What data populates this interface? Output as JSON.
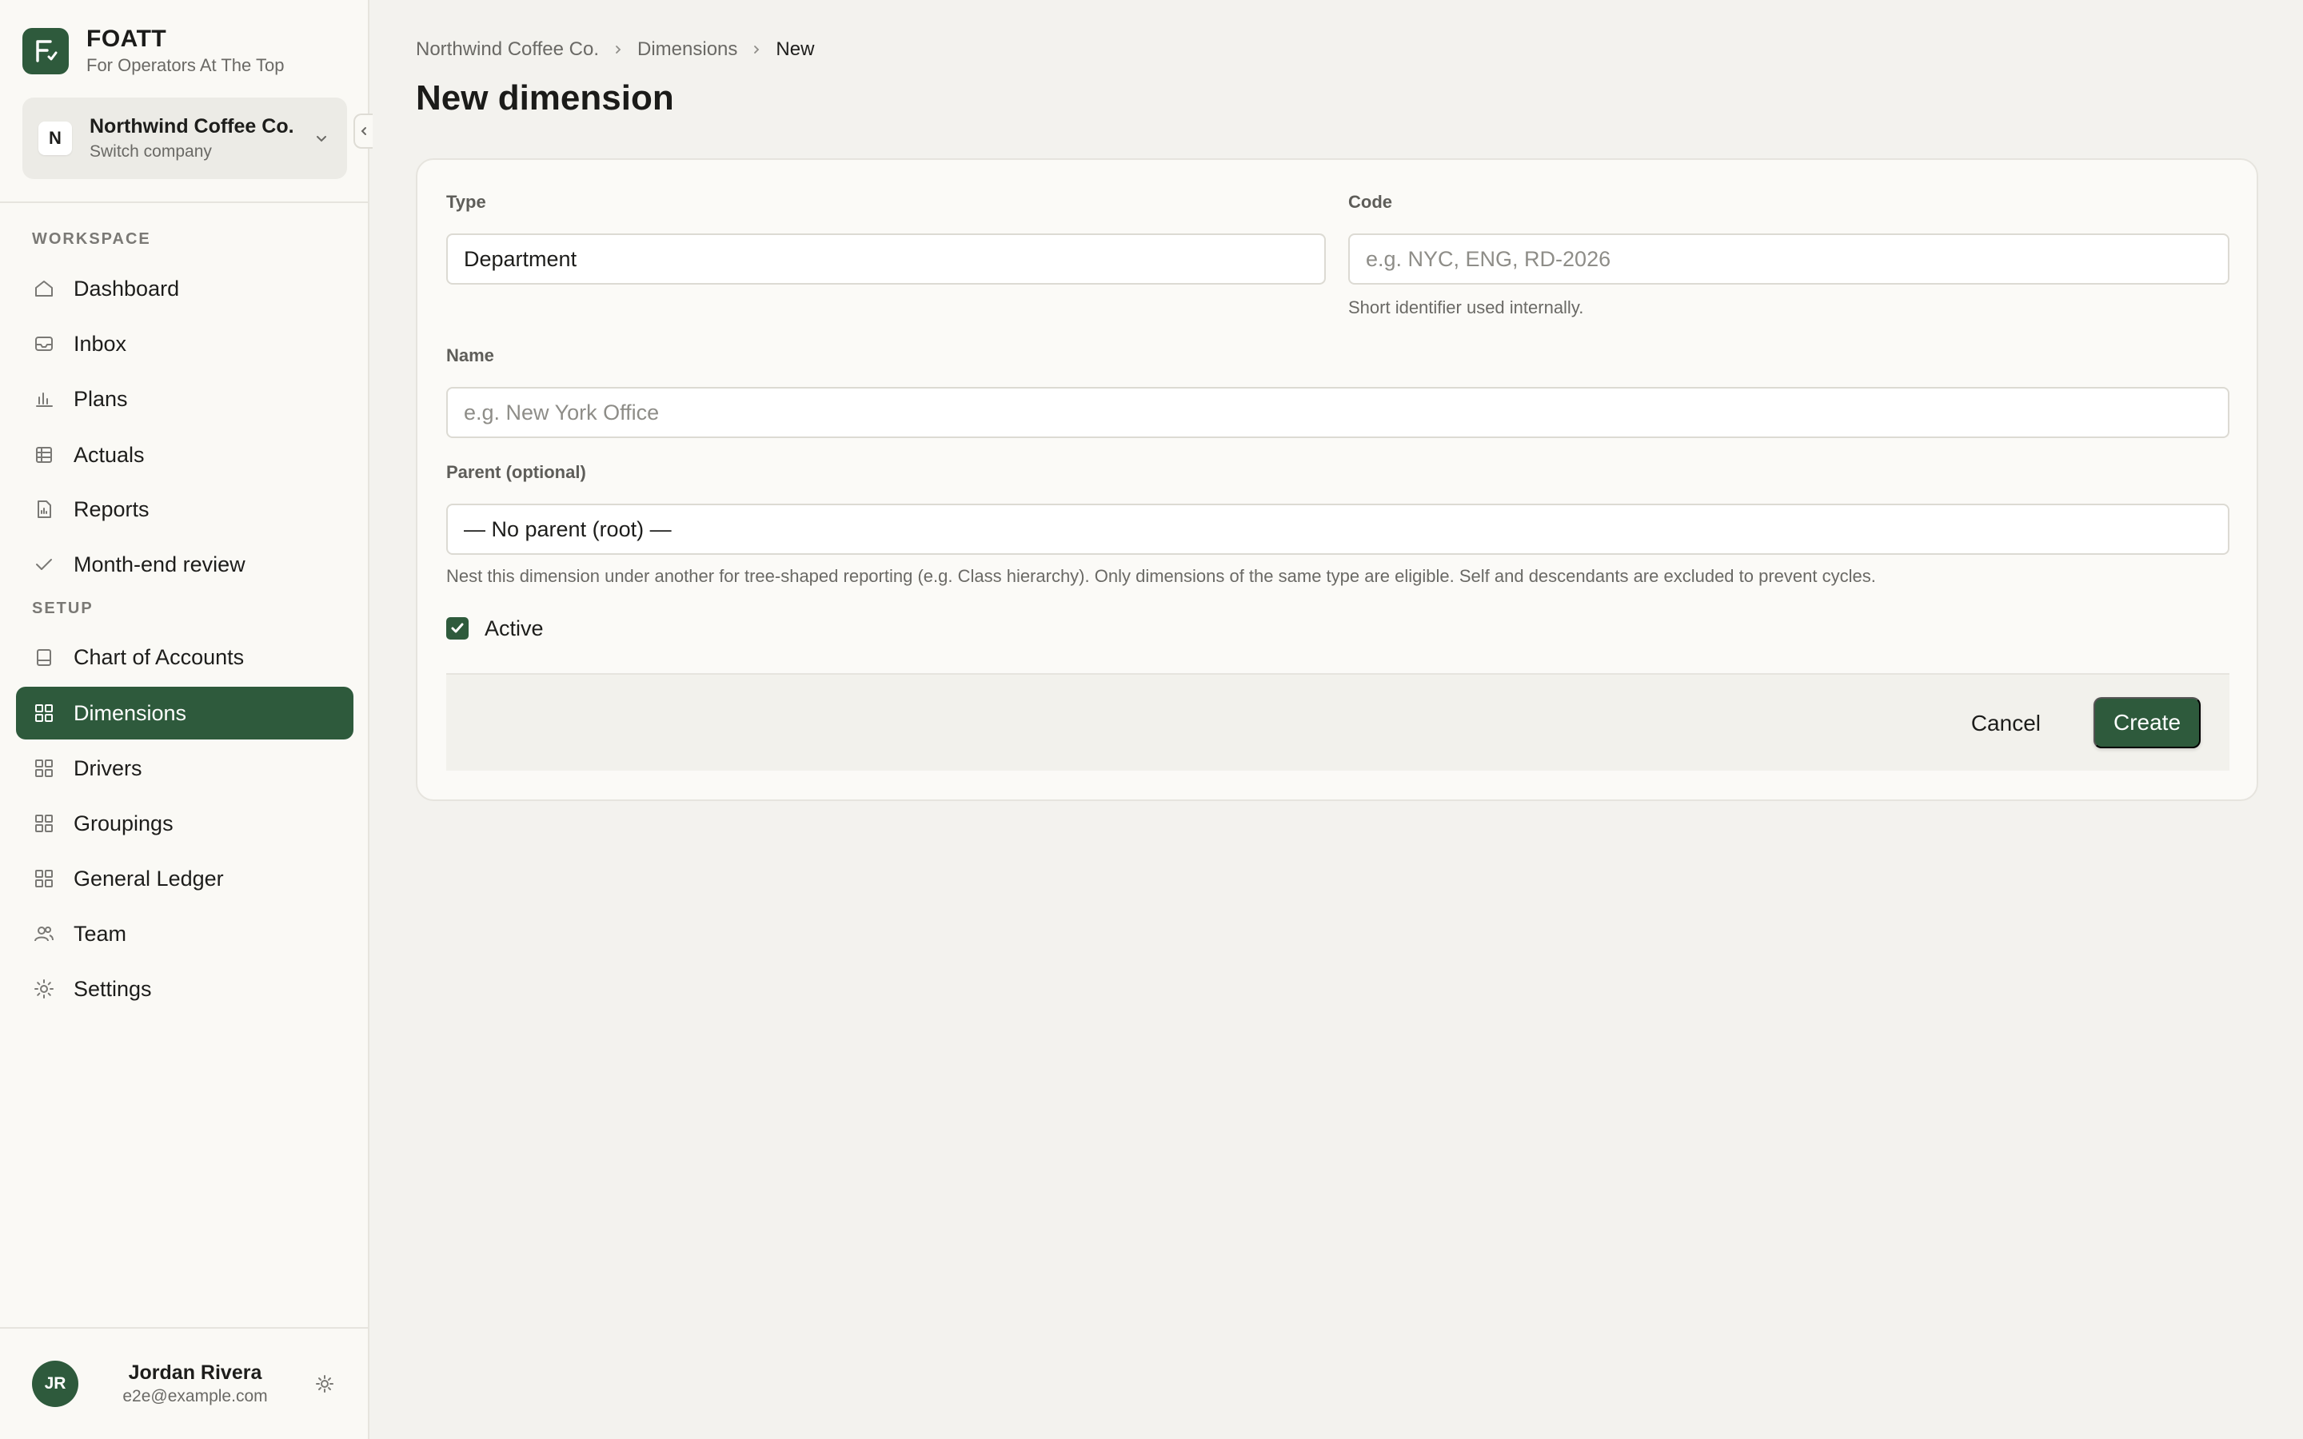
{
  "brand": {
    "name": "FOATT",
    "tagline": "For Operators At The Top",
    "logo_letter": "F"
  },
  "company": {
    "avatar": "N",
    "name": "Northwind Coffee Co.",
    "subtitle": "Switch company"
  },
  "sidebar": {
    "workspace_label": "WORKSPACE",
    "setup_label": "SETUP",
    "workspace_items": [
      {
        "label": "Dashboard",
        "icon": "home-icon"
      },
      {
        "label": "Inbox",
        "icon": "inbox-icon"
      },
      {
        "label": "Plans",
        "icon": "bar-chart-icon"
      },
      {
        "label": "Actuals",
        "icon": "table-icon"
      },
      {
        "label": "Reports",
        "icon": "report-icon"
      },
      {
        "label": "Month-end review",
        "icon": "check-icon"
      }
    ],
    "setup_items": [
      {
        "label": "Chart of Accounts",
        "icon": "book-icon"
      },
      {
        "label": "Dimensions",
        "icon": "grid-icon",
        "active": true
      },
      {
        "label": "Drivers",
        "icon": "grid-icon"
      },
      {
        "label": "Groupings",
        "icon": "grid-icon"
      },
      {
        "label": "General Ledger",
        "icon": "grid-icon"
      },
      {
        "label": "Team",
        "icon": "users-icon"
      },
      {
        "label": "Settings",
        "icon": "gear-icon"
      }
    ]
  },
  "user": {
    "initials": "JR",
    "name": "Jordan Rivera",
    "email": "e2e@example.com"
  },
  "breadcrumb": [
    "Northwind Coffee Co.",
    "Dimensions",
    "New"
  ],
  "page": {
    "title": "New dimension"
  },
  "form": {
    "type_label": "Type",
    "type_value": "Department",
    "code_label": "Code",
    "code_placeholder": "e.g. NYC, ENG, RD-2026",
    "code_help": "Short identifier used internally.",
    "name_label": "Name",
    "name_placeholder": "e.g. New York Office",
    "parent_label": "Parent (optional)",
    "parent_value": "— No parent (root) —",
    "parent_help": "Nest this dimension under another for tree-shaped reporting (e.g. Class hierarchy). Only dimensions of the same type are eligible. Self and descendants are excluded to prevent cycles.",
    "active_label": "Active",
    "active_checked": true,
    "cancel_label": "Cancel",
    "create_label": "Create"
  },
  "colors": {
    "accent": "#2e5a3c",
    "background": "#f3f2ee",
    "sidebar": "#faf9f5"
  }
}
